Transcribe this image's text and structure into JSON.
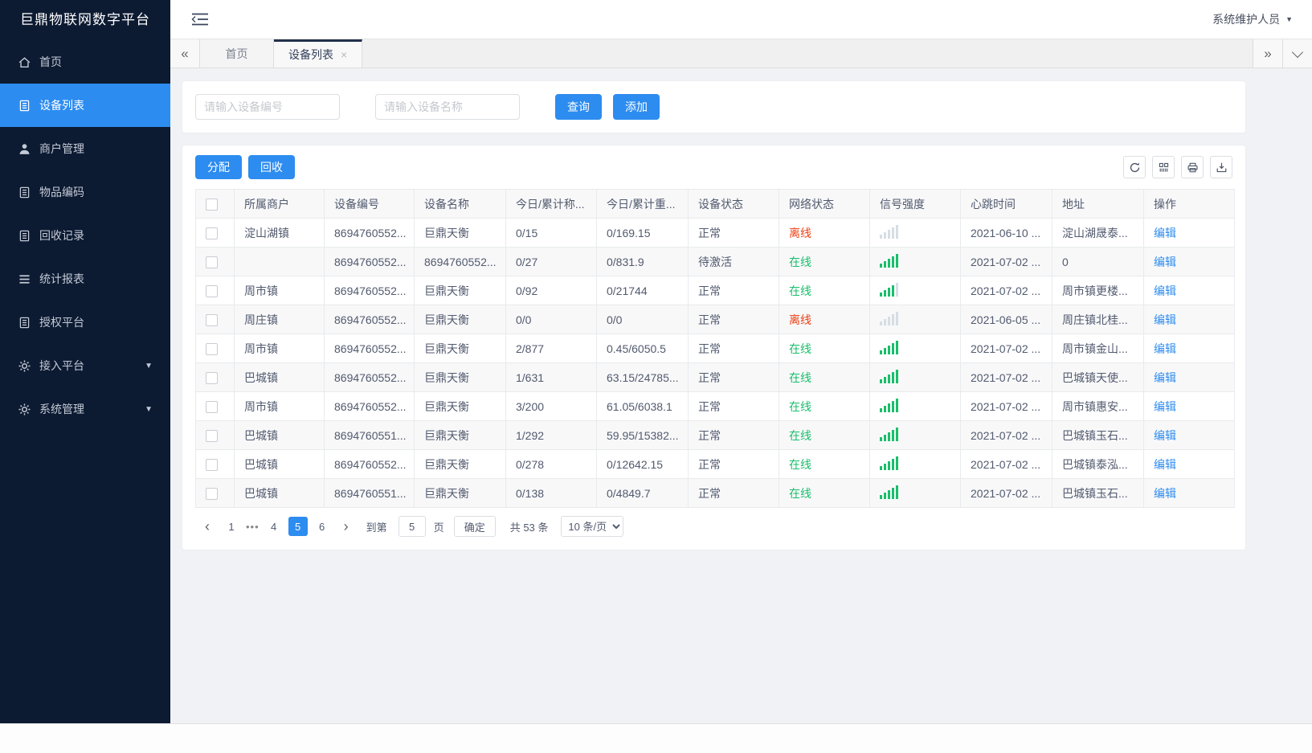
{
  "colors": {
    "accent": "#2d8cf0",
    "success": "#19be6b",
    "danger": "#ed4014",
    "sidebar_bg": "#0c1a32"
  },
  "app": {
    "title": "巨鼎物联网数字平台"
  },
  "header": {
    "user": "系统维护人员"
  },
  "tabs": [
    {
      "key": "home",
      "label": "首页",
      "active": false,
      "closable": false
    },
    {
      "key": "device-list",
      "label": "设备列表",
      "active": true,
      "closable": true
    }
  ],
  "sidebar": {
    "items": [
      {
        "key": "home",
        "label": "首页",
        "icon": "home-icon",
        "active": false,
        "arrow": false
      },
      {
        "key": "device-list",
        "label": "设备列表",
        "icon": "doc-icon",
        "active": true,
        "arrow": false
      },
      {
        "key": "merchant-mgmt",
        "label": "商户管理",
        "icon": "user-icon",
        "active": false,
        "arrow": false
      },
      {
        "key": "item-code",
        "label": "物品编码",
        "icon": "doc-icon",
        "active": false,
        "arrow": false
      },
      {
        "key": "recycle-record",
        "label": "回收记录",
        "icon": "doc-icon",
        "active": false,
        "arrow": false
      },
      {
        "key": "stats-report",
        "label": "统计报表",
        "icon": "list-icon",
        "active": false,
        "arrow": false
      },
      {
        "key": "auth-platform",
        "label": "授权平台",
        "icon": "doc-icon",
        "active": false,
        "arrow": false
      },
      {
        "key": "access-platform",
        "label": "接入平台",
        "icon": "gear-icon",
        "active": false,
        "arrow": true
      },
      {
        "key": "system-mgmt",
        "label": "系统管理",
        "icon": "gear-icon",
        "active": false,
        "arrow": true
      }
    ]
  },
  "search": {
    "device_no_placeholder": "请输入设备编号",
    "device_name_placeholder": "请输入设备名称",
    "query_label": "查询",
    "add_label": "添加"
  },
  "toolbar": {
    "assign_label": "分配",
    "recycle_label": "回收",
    "icons": [
      "refresh-icon",
      "columns-icon",
      "print-icon",
      "export-icon"
    ]
  },
  "table": {
    "columns": [
      "所属商户",
      "设备编号",
      "设备名称",
      "今日/累计称...",
      "今日/累计重...",
      "设备状态",
      "网络状态",
      "信号强度",
      "心跳时间",
      "地址",
      "操作"
    ],
    "edit_label": "编辑",
    "rows": [
      {
        "merchant": "淀山湖镇",
        "device_no": "8694760552...",
        "device_name": "巨鼎天衡",
        "today_count": "0/15",
        "today_weight": "0/169.15",
        "device_status": "正常",
        "network_status": "离线",
        "online": false,
        "signal": 0,
        "heartbeat": "2021-06-10 ...",
        "address": "淀山湖晟泰..."
      },
      {
        "merchant": "",
        "device_no": "8694760552...",
        "device_name": "8694760552...",
        "today_count": "0/27",
        "today_weight": "0/831.9",
        "device_status": "待激活",
        "network_status": "在线",
        "online": true,
        "signal": 5,
        "heartbeat": "2021-07-02 ...",
        "address": "0"
      },
      {
        "merchant": "周市镇",
        "device_no": "8694760552...",
        "device_name": "巨鼎天衡",
        "today_count": "0/92",
        "today_weight": "0/21744",
        "device_status": "正常",
        "network_status": "在线",
        "online": true,
        "signal": 4,
        "heartbeat": "2021-07-02 ...",
        "address": "周市镇更楼..."
      },
      {
        "merchant": "周庄镇",
        "device_no": "8694760552...",
        "device_name": "巨鼎天衡",
        "today_count": "0/0",
        "today_weight": "0/0",
        "device_status": "正常",
        "network_status": "离线",
        "online": false,
        "signal": 0,
        "heartbeat": "2021-06-05 ...",
        "address": "周庄镇北桂..."
      },
      {
        "merchant": "周市镇",
        "device_no": "8694760552...",
        "device_name": "巨鼎天衡",
        "today_count": "2/877",
        "today_weight": "0.45/6050.5",
        "device_status": "正常",
        "network_status": "在线",
        "online": true,
        "signal": 5,
        "heartbeat": "2021-07-02 ...",
        "address": "周市镇金山..."
      },
      {
        "merchant": "巴城镇",
        "device_no": "8694760552...",
        "device_name": "巨鼎天衡",
        "today_count": "1/631",
        "today_weight": "63.15/24785...",
        "device_status": "正常",
        "network_status": "在线",
        "online": true,
        "signal": 5,
        "heartbeat": "2021-07-02 ...",
        "address": "巴城镇天使..."
      },
      {
        "merchant": "周市镇",
        "device_no": "8694760552...",
        "device_name": "巨鼎天衡",
        "today_count": "3/200",
        "today_weight": "61.05/6038.1",
        "device_status": "正常",
        "network_status": "在线",
        "online": true,
        "signal": 5,
        "heartbeat": "2021-07-02 ...",
        "address": "周市镇惠安..."
      },
      {
        "merchant": "巴城镇",
        "device_no": "8694760551...",
        "device_name": "巨鼎天衡",
        "today_count": "1/292",
        "today_weight": "59.95/15382...",
        "device_status": "正常",
        "network_status": "在线",
        "online": true,
        "signal": 5,
        "heartbeat": "2021-07-02 ...",
        "address": "巴城镇玉石..."
      },
      {
        "merchant": "巴城镇",
        "device_no": "8694760552...",
        "device_name": "巨鼎天衡",
        "today_count": "0/278",
        "today_weight": "0/12642.15",
        "device_status": "正常",
        "network_status": "在线",
        "online": true,
        "signal": 5,
        "heartbeat": "2021-07-02 ...",
        "address": "巴城镇泰泓..."
      },
      {
        "merchant": "巴城镇",
        "device_no": "8694760551...",
        "device_name": "巨鼎天衡",
        "today_count": "0/138",
        "today_weight": "0/4849.7",
        "device_status": "正常",
        "network_status": "在线",
        "online": true,
        "signal": 5,
        "heartbeat": "2021-07-02 ...",
        "address": "巴城镇玉石..."
      }
    ]
  },
  "pagination": {
    "prev": "‹",
    "next": "›",
    "pages": [
      "1",
      "...",
      "4",
      "5",
      "6"
    ],
    "active_page": "5",
    "goto_label": "到第",
    "goto_value": "5",
    "page_unit": "页",
    "confirm_label": "确定",
    "total_text": "共 53 条",
    "page_size": "10 条/页"
  }
}
